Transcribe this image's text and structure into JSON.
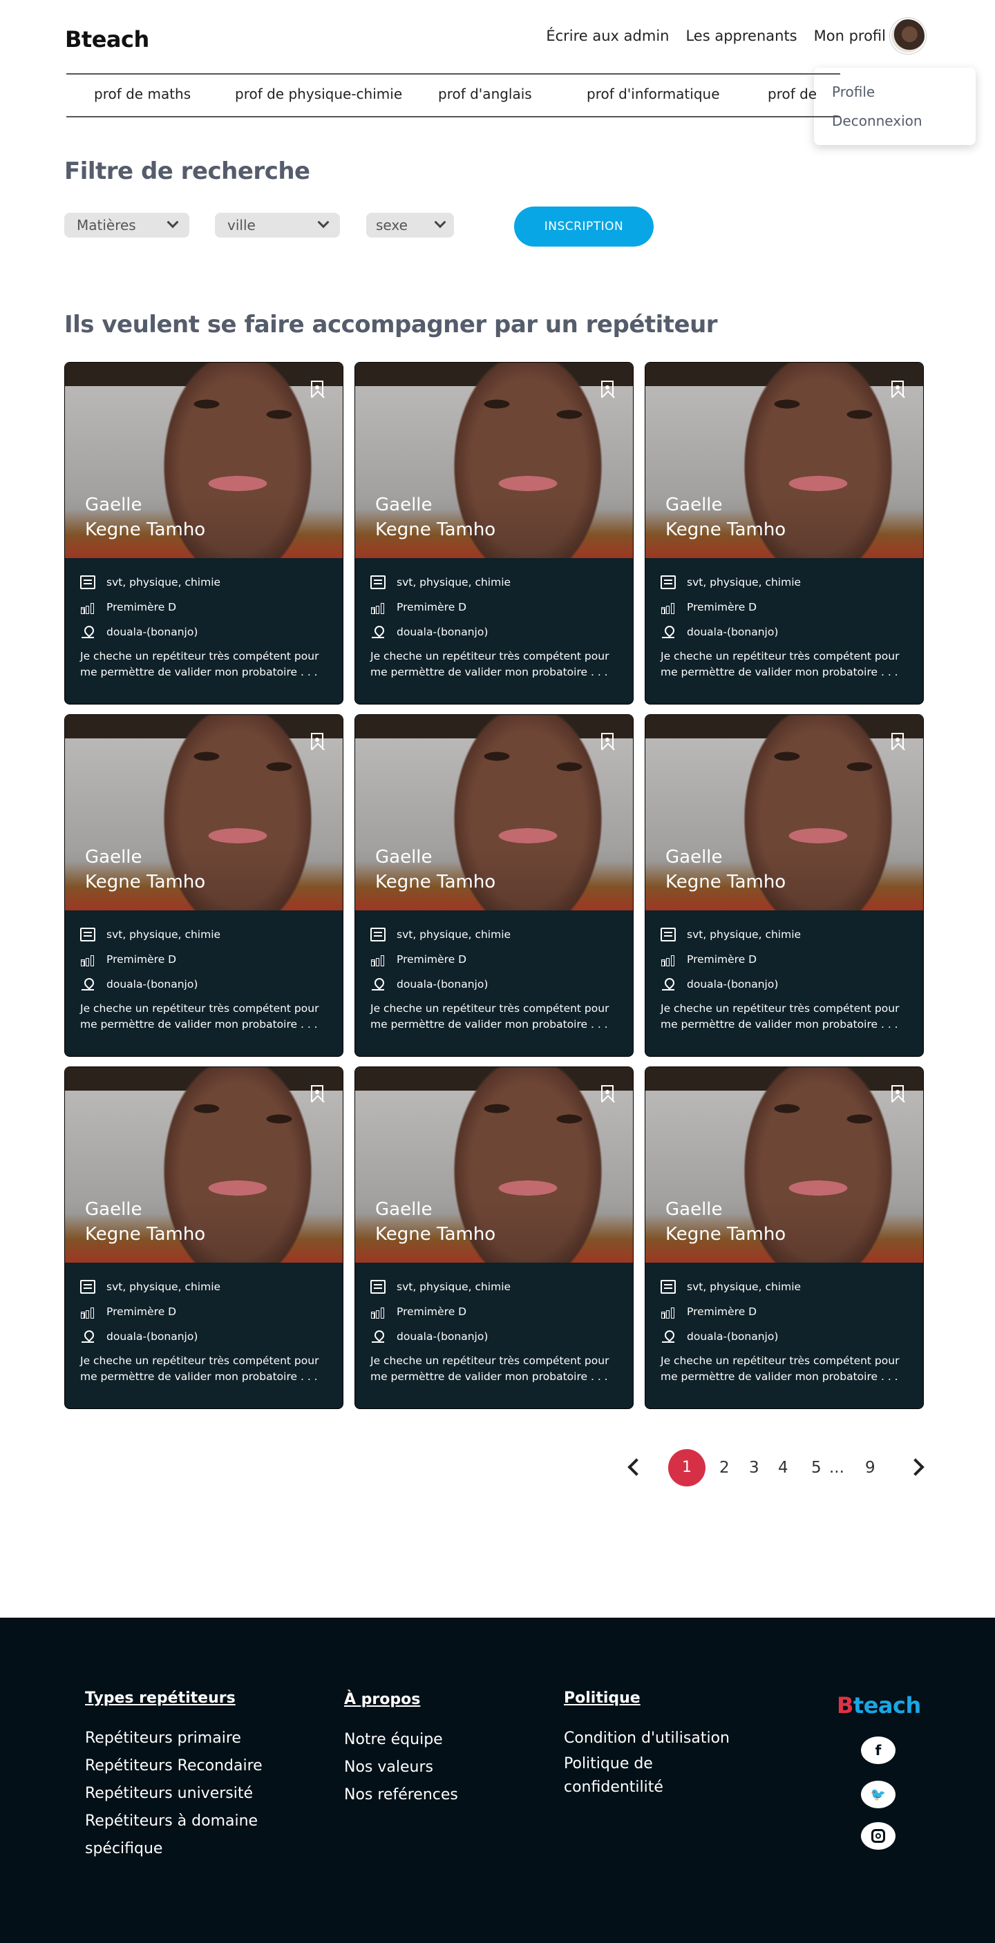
{
  "header": {
    "logo": "Bteach",
    "nav": [
      "Écrire aux admin",
      "Les apprenants",
      "Mon profil"
    ]
  },
  "dropdown": {
    "items": [
      "Profile",
      "Deconnexion"
    ]
  },
  "categories": [
    "prof de maths",
    "prof de physique-chimie",
    "prof d'anglais",
    "prof d'informatique",
    "prof de"
  ],
  "filters": {
    "title": "Filtre de recherche",
    "matieres": "Matières",
    "ville": "ville",
    "sexe": "sexe",
    "button": "INSCRIPTION"
  },
  "listing": {
    "title": "Ils veulent se faire accompagner par un repétiteur",
    "cards": [
      {
        "first": "Gaelle",
        "last": "Kegne Tamho",
        "subjects": "svt, physique, chimie",
        "level": "Premimère D",
        "location": "douala-(bonanjo)",
        "desc1": "Je cheche un repétiteur très compétent pour",
        "desc2": "me permèttre de valider mon probatoire . . ."
      },
      {
        "first": "Gaelle",
        "last": "Kegne Tamho",
        "subjects": "svt, physique, chimie",
        "level": "Premimère D",
        "location": "douala-(bonanjo)",
        "desc1": "Je cheche un repétiteur très compétent pour",
        "desc2": "me permèttre de valider mon probatoire . . ."
      },
      {
        "first": "Gaelle",
        "last": "Kegne Tamho",
        "subjects": "svt, physique, chimie",
        "level": "Premimère D",
        "location": "douala-(bonanjo)",
        "desc1": "Je cheche un repétiteur très compétent pour",
        "desc2": "me permèttre de valider mon probatoire . . ."
      },
      {
        "first": "Gaelle",
        "last": "Kegne Tamho",
        "subjects": "svt, physique, chimie",
        "level": "Premimère D",
        "location": "douala-(bonanjo)",
        "desc1": "Je cheche un repétiteur très compétent pour",
        "desc2": "me permèttre de valider mon probatoire . . ."
      },
      {
        "first": "Gaelle",
        "last": "Kegne Tamho",
        "subjects": "svt, physique, chimie",
        "level": "Premimère D",
        "location": "douala-(bonanjo)",
        "desc1": "Je cheche un repétiteur très compétent pour",
        "desc2": "me permèttre de valider mon probatoire . . ."
      },
      {
        "first": "Gaelle",
        "last": "Kegne Tamho",
        "subjects": "svt, physique, chimie",
        "level": "Premimère D",
        "location": "douala-(bonanjo)",
        "desc1": "Je cheche un repétiteur très compétent pour",
        "desc2": "me permèttre de valider mon probatoire  . . ."
      },
      {
        "first": "Gaelle",
        "last": "Kegne Tamho",
        "subjects": "svt, physique, chimie",
        "level": "Premimère D",
        "location": "douala-(bonanjo)",
        "desc1": "Je cheche un repétiteur très compétent pour",
        "desc2": "me permèttre de valider mon probatoire . . ."
      },
      {
        "first": "Gaelle",
        "last": "Kegne Tamho",
        "subjects": "svt, physique, chimie",
        "level": "Premimère D",
        "location": "douala-(bonanjo)",
        "desc1": "Je cheche un repétiteur très compétent pour",
        "desc2": "me permèttre de valider mon probatoire . . ."
      },
      {
        "first": "Gaelle",
        "last": "Kegne Tamho",
        "subjects": "svt, physique, chimie",
        "level": "Premimère D",
        "location": "douala-(bonanjo)",
        "desc1": "Je cheche un repétiteur très compétent pour",
        "desc2": "me permèttre de valider mon probatoire  . . ."
      }
    ]
  },
  "pagination": {
    "active": "1",
    "pages": [
      "2",
      "3",
      "4",
      "5"
    ],
    "ellipsis": "...",
    "last": "9"
  },
  "footer": {
    "col1": {
      "title": "Types repétiteurs",
      "items": [
        "Repétiteurs primaire",
        "Repétiteurs Recondaire",
        "Repétiteurs université",
        "Repétiteurs à domaine",
        "spécifique"
      ]
    },
    "col2": {
      "title": "À propos",
      "items": [
        "Notre équipe",
        "Nos valeurs",
        "Nos reférences"
      ]
    },
    "col3": {
      "title": "Politique",
      "items": [
        "Condition d'utilisation",
        "Politique de",
        "confidentilité"
      ]
    },
    "logo_b": "B",
    "logo_rest": "teach",
    "social": [
      "facebook-icon",
      "twitter-icon",
      "instagram-icon"
    ]
  }
}
